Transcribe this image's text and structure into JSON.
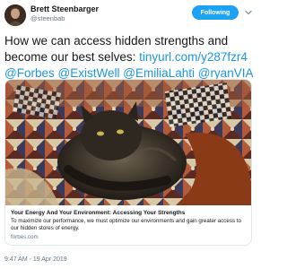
{
  "author": {
    "name": "Brett Steenbarger",
    "handle": "@steenbab",
    "avatar_icon": "profile-photo"
  },
  "follow_button": {
    "label": "Following"
  },
  "tweet": {
    "text_main": "How we can access hidden strengths and become our best selves: ",
    "link_url": "tinyurl.com/y287fzr4",
    "mentions": [
      "@Forbes",
      "@ExistWell",
      "@EmiliaLahti",
      "@ryanVIA"
    ]
  },
  "card": {
    "image_icon": "cat-on-blanket-photo",
    "title": "Your Energy And Your Environment: Accessing Your Strengths",
    "description": "To maximize our performance, we must optimize our environments and gain greater access to our hidden stores of energy.",
    "domain": "forbes.com"
  },
  "timestamp": "9:47 AM - 19 Apr 2019",
  "colors": {
    "accent": "#1da1f2",
    "link": "#1b95e0",
    "muted": "#657786",
    "border": "#e1e8ed"
  }
}
